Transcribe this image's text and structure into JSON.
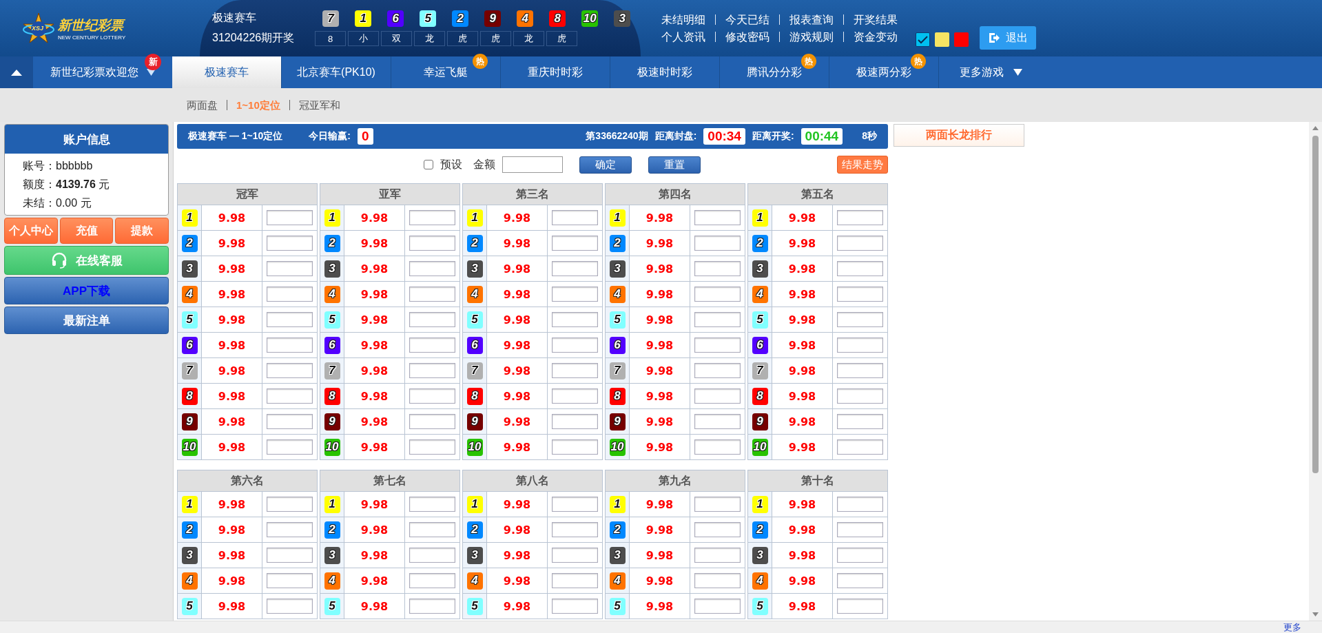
{
  "logo": {
    "name": "新世纪彩票",
    "subtitle": "NEW CENTURY LOTTERY",
    "badge": "XSJ"
  },
  "draw": {
    "game": "极速赛车",
    "period": "31204226期开奖",
    "balls": [
      {
        "number": "7",
        "color": "#b0b0b0"
      },
      {
        "number": "1",
        "color": "#ffff00"
      },
      {
        "number": "6",
        "color": "#5200ff"
      },
      {
        "number": "5",
        "color": "#80ffff"
      },
      {
        "number": "2",
        "color": "#0088ff"
      },
      {
        "number": "9",
        "color": "#760000"
      },
      {
        "number": "4",
        "color": "#ff7300"
      },
      {
        "number": "8",
        "color": "#ff0000"
      },
      {
        "number": "10",
        "color": "#28c200"
      },
      {
        "number": "3",
        "color": "#4d4d4d"
      }
    ],
    "stats": [
      "8",
      "小",
      "双",
      "龙",
      "虎",
      "虎",
      "龙",
      "虎"
    ]
  },
  "top_links": [
    [
      "未结明细",
      "今天已结",
      "报表查询",
      "开奖结果"
    ],
    [
      "个人资讯",
      "修改密码",
      "游戏规则",
      "资金变动"
    ]
  ],
  "themes": [
    {
      "color": "#00c0f0",
      "selected": true
    },
    {
      "color": "#f7e463",
      "selected": false
    },
    {
      "color": "#ff0000",
      "selected": false
    }
  ],
  "logout": "退出",
  "nav": {
    "welcome": "新世纪彩票欢迎您",
    "welcome_badge": "新",
    "more": "更多游戏",
    "tabs": [
      {
        "label": "极速赛车",
        "selected": true
      },
      {
        "label": "北京赛车(PK10)",
        "selected": false
      },
      {
        "label": "幸运飞艇",
        "selected": false,
        "badge": "热"
      },
      {
        "label": "重庆时时彩",
        "selected": false
      },
      {
        "label": "极速时时彩",
        "selected": false
      },
      {
        "label": "腾讯分分彩",
        "selected": false,
        "badge": "热"
      },
      {
        "label": "极速两分彩",
        "selected": false,
        "badge": "热"
      }
    ]
  },
  "sub_tabs": [
    {
      "label": "两面盘",
      "selected": false
    },
    {
      "label": "1~10定位",
      "selected": true
    },
    {
      "label": "冠亚军和",
      "selected": false
    }
  ],
  "account": {
    "title": "账户信息",
    "fields": [
      {
        "label": "账号：",
        "value": "bbbbbb",
        "bold": false
      },
      {
        "label": "额度：",
        "value": "4139.76",
        "unit": "元",
        "bold": true
      },
      {
        "label": "未结：",
        "value": "0.00",
        "unit": "元",
        "bold": false
      }
    ]
  },
  "quick_actions": [
    "个人中心",
    "充值",
    "提款"
  ],
  "side_buttons": [
    {
      "label": "在线客服",
      "kind": "service"
    },
    {
      "label": "APP下载",
      "kind": "download"
    },
    {
      "label": "最新注单",
      "kind": "plain"
    }
  ],
  "bet_header": {
    "title": "极速赛车 — 1~10定位",
    "profit_label": "今日输赢:",
    "profit": "0",
    "period": "第33662240期",
    "close_label": "距离封盘:",
    "close_time": "00:34",
    "open_label": "距离开奖:",
    "open_time": "00:44",
    "seconds": "8秒"
  },
  "ranking_link": "两面长龙排行",
  "controls": {
    "preset_label": "预设",
    "preset_checked": false,
    "amount_label": "金额",
    "confirm": "确定",
    "reset": "重置",
    "trend": "结果走势"
  },
  "groups": [
    {
      "title": "冠军",
      "rows": [
        {
          "number": "1",
          "color": "#ffff00",
          "odds": "9.98"
        },
        {
          "number": "2",
          "color": "#0088ff",
          "odds": "9.98"
        },
        {
          "number": "3",
          "color": "#4d4d4d",
          "odds": "9.98"
        },
        {
          "number": "4",
          "color": "#ff7300",
          "odds": "9.98"
        },
        {
          "number": "5",
          "color": "#80ffff",
          "odds": "9.98"
        },
        {
          "number": "6",
          "color": "#5200ff",
          "odds": "9.98"
        },
        {
          "number": "7",
          "color": "#b0b0b0",
          "odds": "9.98"
        },
        {
          "number": "8",
          "color": "#ff0000",
          "odds": "9.98"
        },
        {
          "number": "9",
          "color": "#760000",
          "odds": "9.98"
        },
        {
          "number": "10",
          "color": "#28c200",
          "odds": "9.98"
        }
      ]
    },
    {
      "title": "亚军",
      "rows": [
        {
          "number": "1",
          "color": "#ffff00",
          "odds": "9.98"
        },
        {
          "number": "2",
          "color": "#0088ff",
          "odds": "9.98"
        },
        {
          "number": "3",
          "color": "#4d4d4d",
          "odds": "9.98"
        },
        {
          "number": "4",
          "color": "#ff7300",
          "odds": "9.98"
        },
        {
          "number": "5",
          "color": "#80ffff",
          "odds": "9.98"
        },
        {
          "number": "6",
          "color": "#5200ff",
          "odds": "9.98"
        },
        {
          "number": "7",
          "color": "#b0b0b0",
          "odds": "9.98"
        },
        {
          "number": "8",
          "color": "#ff0000",
          "odds": "9.98"
        },
        {
          "number": "9",
          "color": "#760000",
          "odds": "9.98"
        },
        {
          "number": "10",
          "color": "#28c200",
          "odds": "9.98"
        }
      ]
    },
    {
      "title": "第三名",
      "rows": [
        {
          "number": "1",
          "color": "#ffff00",
          "odds": "9.98"
        },
        {
          "number": "2",
          "color": "#0088ff",
          "odds": "9.98"
        },
        {
          "number": "3",
          "color": "#4d4d4d",
          "odds": "9.98"
        },
        {
          "number": "4",
          "color": "#ff7300",
          "odds": "9.98"
        },
        {
          "number": "5",
          "color": "#80ffff",
          "odds": "9.98"
        },
        {
          "number": "6",
          "color": "#5200ff",
          "odds": "9.98"
        },
        {
          "number": "7",
          "color": "#b0b0b0",
          "odds": "9.98"
        },
        {
          "number": "8",
          "color": "#ff0000",
          "odds": "9.98"
        },
        {
          "number": "9",
          "color": "#760000",
          "odds": "9.98"
        },
        {
          "number": "10",
          "color": "#28c200",
          "odds": "9.98"
        }
      ]
    },
    {
      "title": "第四名",
      "rows": [
        {
          "number": "1",
          "color": "#ffff00",
          "odds": "9.98"
        },
        {
          "number": "2",
          "color": "#0088ff",
          "odds": "9.98"
        },
        {
          "number": "3",
          "color": "#4d4d4d",
          "odds": "9.98"
        },
        {
          "number": "4",
          "color": "#ff7300",
          "odds": "9.98"
        },
        {
          "number": "5",
          "color": "#80ffff",
          "odds": "9.98"
        },
        {
          "number": "6",
          "color": "#5200ff",
          "odds": "9.98"
        },
        {
          "number": "7",
          "color": "#b0b0b0",
          "odds": "9.98"
        },
        {
          "number": "8",
          "color": "#ff0000",
          "odds": "9.98"
        },
        {
          "number": "9",
          "color": "#760000",
          "odds": "9.98"
        },
        {
          "number": "10",
          "color": "#28c200",
          "odds": "9.98"
        }
      ]
    },
    {
      "title": "第五名",
      "rows": [
        {
          "number": "1",
          "color": "#ffff00",
          "odds": "9.98"
        },
        {
          "number": "2",
          "color": "#0088ff",
          "odds": "9.98"
        },
        {
          "number": "3",
          "color": "#4d4d4d",
          "odds": "9.98"
        },
        {
          "number": "4",
          "color": "#ff7300",
          "odds": "9.98"
        },
        {
          "number": "5",
          "color": "#80ffff",
          "odds": "9.98"
        },
        {
          "number": "6",
          "color": "#5200ff",
          "odds": "9.98"
        },
        {
          "number": "7",
          "color": "#b0b0b0",
          "odds": "9.98"
        },
        {
          "number": "8",
          "color": "#ff0000",
          "odds": "9.98"
        },
        {
          "number": "9",
          "color": "#760000",
          "odds": "9.98"
        },
        {
          "number": "10",
          "color": "#28c200",
          "odds": "9.98"
        }
      ]
    },
    {
      "title": "第六名",
      "rows": [
        {
          "number": "1",
          "color": "#ffff00",
          "odds": "9.98"
        },
        {
          "number": "2",
          "color": "#0088ff",
          "odds": "9.98"
        },
        {
          "number": "3",
          "color": "#4d4d4d",
          "odds": "9.98"
        },
        {
          "number": "4",
          "color": "#ff7300",
          "odds": "9.98"
        },
        {
          "number": "5",
          "color": "#80ffff",
          "odds": "9.98"
        }
      ]
    },
    {
      "title": "第七名",
      "rows": [
        {
          "number": "1",
          "color": "#ffff00",
          "odds": "9.98"
        },
        {
          "number": "2",
          "color": "#0088ff",
          "odds": "9.98"
        },
        {
          "number": "3",
          "color": "#4d4d4d",
          "odds": "9.98"
        },
        {
          "number": "4",
          "color": "#ff7300",
          "odds": "9.98"
        },
        {
          "number": "5",
          "color": "#80ffff",
          "odds": "9.98"
        }
      ]
    },
    {
      "title": "第八名",
      "rows": [
        {
          "number": "1",
          "color": "#ffff00",
          "odds": "9.98"
        },
        {
          "number": "2",
          "color": "#0088ff",
          "odds": "9.98"
        },
        {
          "number": "3",
          "color": "#4d4d4d",
          "odds": "9.98"
        },
        {
          "number": "4",
          "color": "#ff7300",
          "odds": "9.98"
        },
        {
          "number": "5",
          "color": "#80ffff",
          "odds": "9.98"
        }
      ]
    },
    {
      "title": "第九名",
      "rows": [
        {
          "number": "1",
          "color": "#ffff00",
          "odds": "9.98"
        },
        {
          "number": "2",
          "color": "#0088ff",
          "odds": "9.98"
        },
        {
          "number": "3",
          "color": "#4d4d4d",
          "odds": "9.98"
        },
        {
          "number": "4",
          "color": "#ff7300",
          "odds": "9.98"
        },
        {
          "number": "5",
          "color": "#80ffff",
          "odds": "9.98"
        }
      ]
    },
    {
      "title": "第十名",
      "rows": [
        {
          "number": "1",
          "color": "#ffff00",
          "odds": "9.98"
        },
        {
          "number": "2",
          "color": "#0088ff",
          "odds": "9.98"
        },
        {
          "number": "3",
          "color": "#4d4d4d",
          "odds": "9.98"
        },
        {
          "number": "4",
          "color": "#ff7300",
          "odds": "9.98"
        },
        {
          "number": "5",
          "color": "#80ffff",
          "odds": "9.98"
        }
      ]
    }
  ],
  "footer_link": "更多"
}
